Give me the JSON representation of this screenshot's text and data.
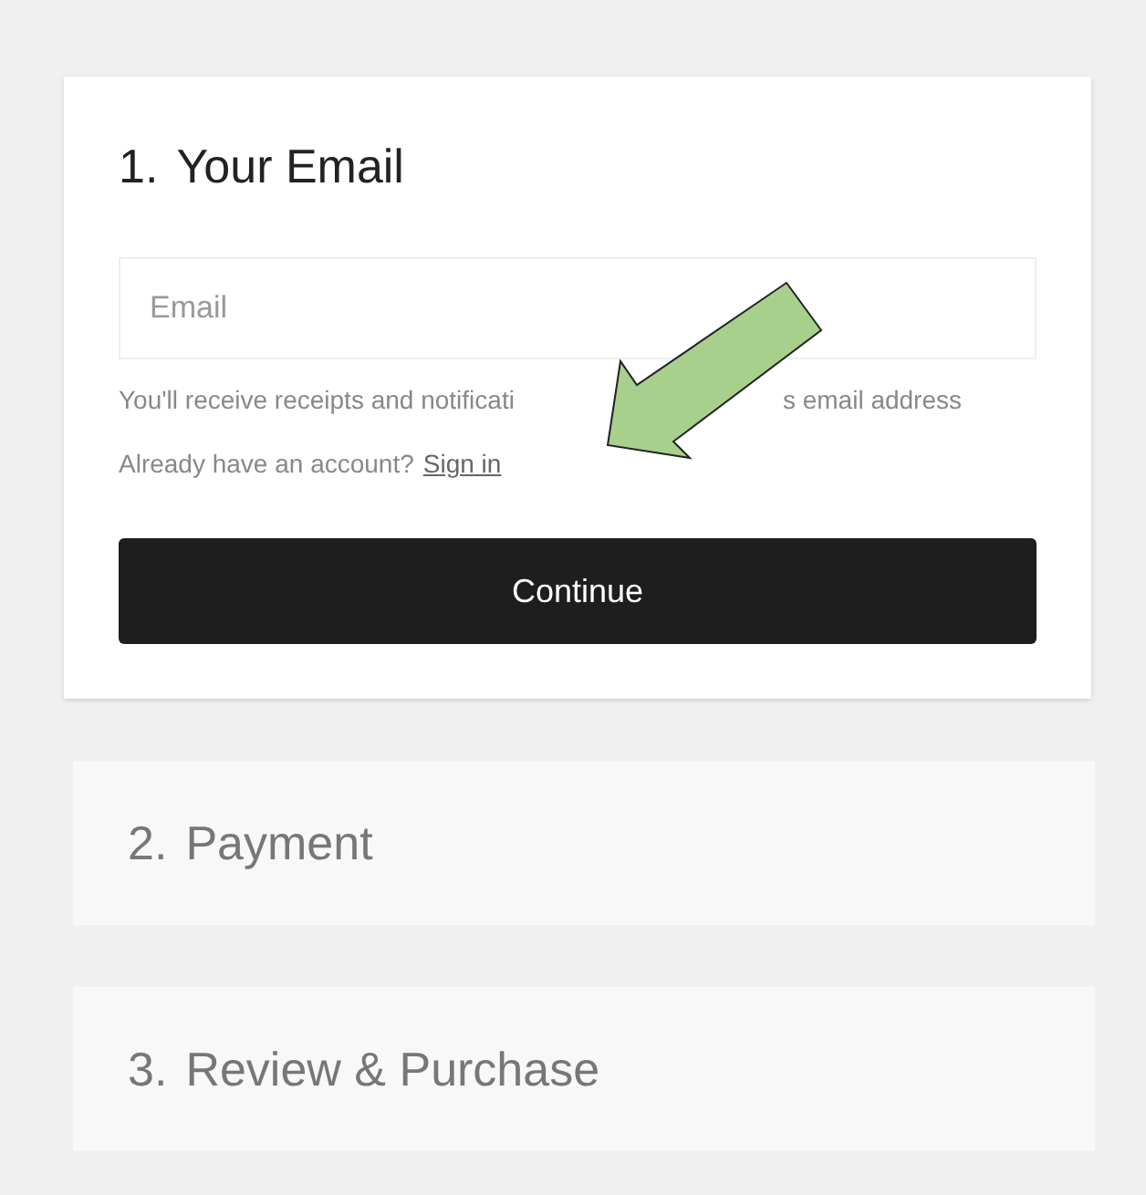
{
  "steps": [
    {
      "number": "1.",
      "title": "Your Email",
      "expanded": true
    },
    {
      "number": "2.",
      "title": "Payment",
      "expanded": false
    },
    {
      "number": "3.",
      "title": "Review & Purchase",
      "expanded": false
    }
  ],
  "email": {
    "placeholder": "Email",
    "hint_parts": [
      "You'll receive receipts and notificati",
      "s email address"
    ],
    "account_prompt": "Already have an account?",
    "sign_in": "Sign in"
  },
  "continue_button": "Continue"
}
